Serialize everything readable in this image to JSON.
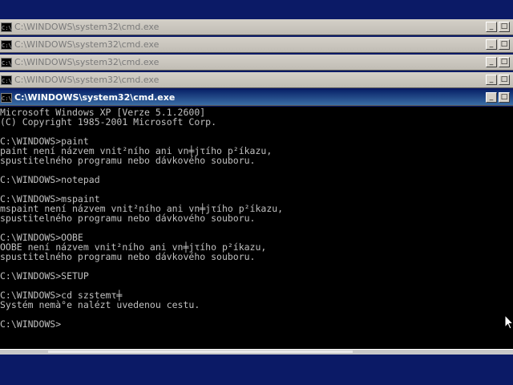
{
  "windows": [
    {
      "title": "C:\\WINDOWS\\system32\\cmd.exe",
      "icon_text": "C:\\"
    },
    {
      "title": "C:\\WINDOWS\\system32\\cmd.exe",
      "icon_text": "C:\\"
    },
    {
      "title": "C:\\WINDOWS\\system32\\cmd.exe",
      "icon_text": "C:\\"
    },
    {
      "title": "C:\\WINDOWS\\system32\\cmd.exe",
      "icon_text": "C:\\"
    },
    {
      "title": "C:\\WINDOWS\\system32\\cmd.exe",
      "icon_text": "C:\\"
    }
  ],
  "controls": {
    "minimize": "_",
    "maximize": "□"
  },
  "console": {
    "lines": [
      "Microsoft Windows XP [Verze 5.1.2600]",
      "(C) Copyright 1985-2001 Microsoft Corp.",
      "",
      "C:\\WINDOWS>paint",
      "paint není názvem vnit²ního ani vn╪jτího p²íkazu,",
      "spustitelného programu nebo dávkového souboru.",
      "",
      "C:\\WINDOWS>notepad",
      "",
      "C:\\WINDOWS>mspaint",
      "mspaint není názvem vnit²ního ani vn╪jτího p²íkazu,",
      "spustitelného programu nebo dávkového souboru.",
      "",
      "C:\\WINDOWS>OOBE",
      "OOBE není názvem vnit²ního ani vn╪jτího p²íkazu,",
      "spustitelného programu nebo dávkového souboru.",
      "",
      "C:\\WINDOWS>SETUP",
      "",
      "C:\\WINDOWS>cd szstemτ╪",
      "Systém nemà°e nalézt uvedenou cestu.",
      "",
      "C:\\WINDOWS>"
    ]
  }
}
